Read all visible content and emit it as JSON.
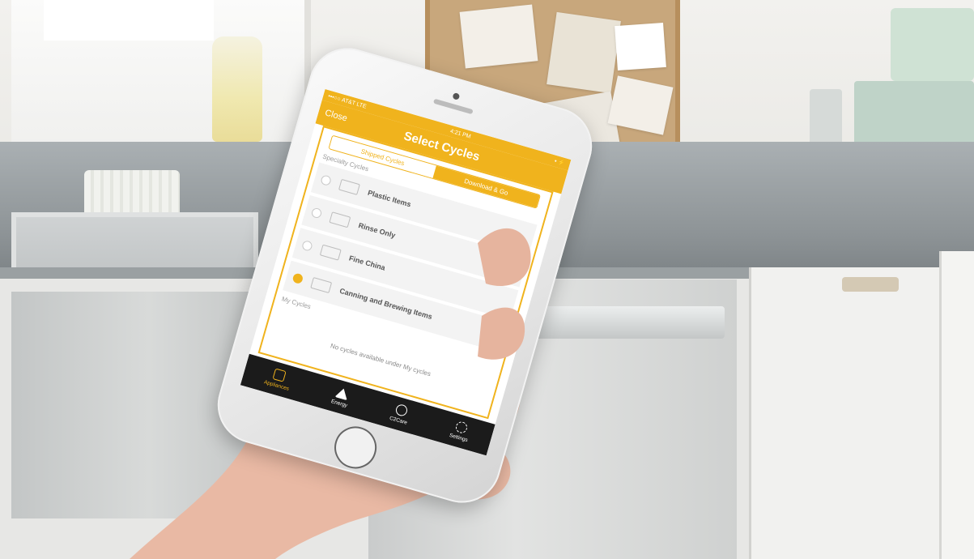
{
  "status_bar": {
    "carrier": "•••○○ AT&T LTE",
    "time": "4:21 PM",
    "battery": "▪ ⚡"
  },
  "nav": {
    "close_label": "Close",
    "title": "Select Cycles"
  },
  "segmented": {
    "tabs": [
      {
        "label": "Shipped Cycles",
        "active": false
      },
      {
        "label": "Download & Go",
        "active": true
      }
    ]
  },
  "specialty": {
    "section_label": "Specialty Cycles",
    "cycles": [
      {
        "label": "Plastic Items",
        "selected": false,
        "icon": "plastic-icon"
      },
      {
        "label": "Rinse Only",
        "selected": false,
        "icon": "rinse-icon"
      },
      {
        "label": "Fine China",
        "selected": false,
        "icon": "china-icon"
      },
      {
        "label": "Canning and Brewing Items",
        "selected": true,
        "icon": "jar-icon"
      }
    ]
  },
  "my_cycles": {
    "section_label": "My Cycles",
    "empty_message": "No cycles available under My cycles"
  },
  "tab_bar": {
    "items": [
      {
        "label": "Appliances",
        "icon": "appliance-icon",
        "active": true
      },
      {
        "label": "Energy",
        "icon": "energy-icon",
        "active": false
      },
      {
        "label": "C2Care",
        "icon": "care-icon",
        "active": false
      },
      {
        "label": "Settings",
        "icon": "gear-icon",
        "active": false
      }
    ]
  },
  "colors": {
    "accent": "#f0b31d",
    "tab_bar_bg": "#1b1b1b"
  }
}
